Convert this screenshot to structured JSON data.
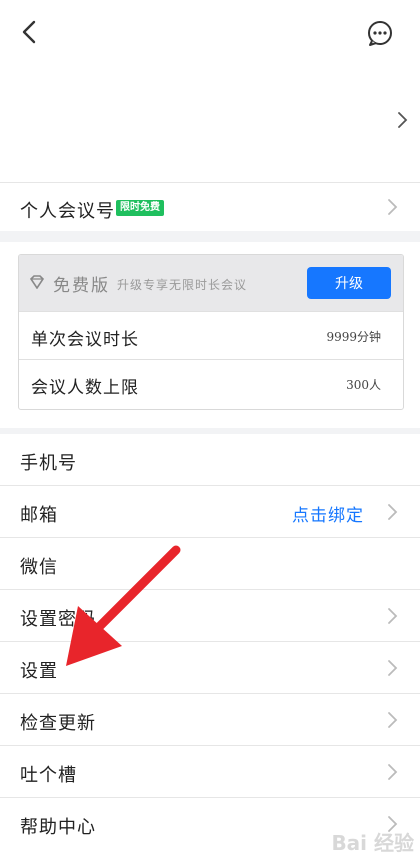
{
  "colors": {
    "accent": "#1677ff",
    "tag_bg": "#1fbf5e",
    "arrow": "#e8252b"
  },
  "personal_meeting": {
    "label": "个人会议号",
    "tag": "限时免费"
  },
  "plan": {
    "title": "免费版",
    "description": "升级专享无限时长会议",
    "upgrade_label": "升级",
    "rows": [
      {
        "label": "单次会议时长",
        "value": "9999分钟"
      },
      {
        "label": "会议人数上限",
        "value": "300人"
      }
    ]
  },
  "menu": [
    {
      "label": "手机号",
      "value": "",
      "chevron": false
    },
    {
      "label": "邮箱",
      "value": "点击绑定",
      "chevron": true
    },
    {
      "label": "微信",
      "value": "",
      "chevron": false
    },
    {
      "label": "设置密码",
      "value": "",
      "chevron": true
    },
    {
      "label": "设置",
      "value": "",
      "chevron": true
    },
    {
      "label": "检查更新",
      "value": "",
      "chevron": true
    },
    {
      "label": "吐个槽",
      "value": "",
      "chevron": true
    },
    {
      "label": "帮助中心",
      "value": "",
      "chevron": true
    }
  ],
  "watermark": "Bai 经验",
  "icons": {
    "back": "chevron-left-icon",
    "message": "chat-bubble-icon",
    "diamond": "diamond-icon"
  }
}
